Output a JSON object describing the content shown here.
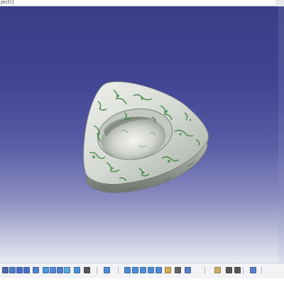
{
  "window": {
    "title": "ject)]"
  },
  "viewport": {
    "background_top": "#3a3d86",
    "background_bottom": "#e9eaf3",
    "model": {
      "name": "triangular-cup-part",
      "texture": "green-marble"
    }
  },
  "toolbar": {
    "buttons": [
      {
        "icon": "select-arrow-icon",
        "color": "#2b4f9e"
      },
      {
        "icon": "fly-mode-icon",
        "color": "#2f6ac7"
      },
      {
        "icon": "zoom-in-icon",
        "color": "#2a59c0"
      },
      {
        "icon": "zoom-out-icon",
        "color": "#2a59c0"
      },
      {
        "icon": "normal-view-icon",
        "color": "#3a6fd1"
      },
      {
        "icon": "multi-view-icon",
        "color": "#2e8ad8"
      },
      {
        "icon": "iso-view-icon",
        "color": "#3a77d4"
      },
      {
        "icon": "shading-icon",
        "color": "#2d6ecc"
      },
      {
        "icon": "hide-show-icon",
        "color": "#3aa0de"
      },
      {
        "icon": "swap-visible-icon",
        "color": "#2a7fd0"
      },
      {
        "icon": "measure-icon",
        "color": "#3a3a3a"
      },
      {
        "icon": "view-front-icon",
        "color": "#2f79d3"
      },
      {
        "icon": "view-back-icon",
        "color": "#2f79d3"
      },
      {
        "icon": "view-left-icon",
        "color": "#2f79d3"
      },
      {
        "icon": "view-right-icon",
        "color": "#2f79d3"
      },
      {
        "icon": "view-top-icon",
        "color": "#2f79d3"
      },
      {
        "icon": "view-bottom-icon",
        "color": "#2f79d3"
      },
      {
        "icon": "material-icon",
        "color": "#d4a132"
      },
      {
        "icon": "render-style-icon",
        "color": "#4a4a4a"
      },
      {
        "icon": "lighting-icon",
        "color": "#3a6ec4"
      },
      {
        "icon": "apply-material-icon",
        "color": "#c9a24a"
      },
      {
        "icon": "tools-icon",
        "color": "#3a3a3a"
      },
      {
        "icon": "link-icon",
        "color": "#3a3a3a"
      },
      {
        "icon": "snap-icon",
        "color": "#3a6ec4"
      }
    ]
  }
}
